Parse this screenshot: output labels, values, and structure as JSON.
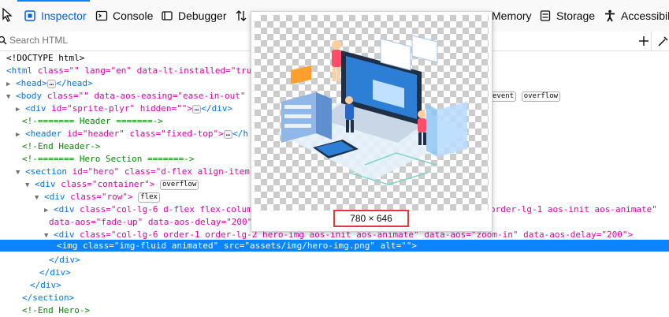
{
  "toolbar": {
    "tabs": [
      {
        "label": "Inspector",
        "icon": "inspector-icon"
      },
      {
        "label": "Console",
        "icon": "console-icon"
      },
      {
        "label": "Debugger",
        "icon": "debugger-icon"
      },
      {
        "label": "Memory",
        "icon": "memory-icon"
      },
      {
        "label": "Storage",
        "icon": "storage-icon"
      },
      {
        "label": "Accessibili",
        "icon": "accessibility-icon"
      }
    ]
  },
  "search": {
    "placeholder": "Search HTML"
  },
  "markup": {
    "l1": "<!DOCTYPE html>",
    "l2_tag": "<html",
    "l2_attrs": " class=\"\" lang=\"en\" data-lt-installed=\"tru",
    "l3": "<head>",
    "l3_end": "</head>",
    "l4_tag": "<body",
    "l4_attr": " class=\"\" data-aos-easing=\"ease-in-out\" d",
    "l4_badge1": "event",
    "l4_badge2": "overflow",
    "l5_tag": "<div",
    "l5_attr": " id=\"sprite-plyr\" hidden=\"\">",
    "l5_end": "</div>",
    "l6": "<!-======= Header =======->",
    "l7_tag": "<header",
    "l7_attr": " id=\"header\" class=\"fixed-top\">",
    "l7_end": "</h",
    "l8": "<!-End Header->",
    "l9": "<!-======= Hero Section =======->",
    "l10_tag": "<section",
    "l10_attr": " id=\"hero\" class=\"d-flex align-items",
    "l11_tag": "<div",
    "l11_attr": " class=\"container\">",
    "l11_badge": "overflow",
    "l12_tag": "<div",
    "l12_attr": " class=\"row\">",
    "l12_badge": "flex",
    "l13_tag": "<div",
    "l13_attr": " class=\"col-lg-6 d-flex flex-column",
    "l13_right": "order-lg-1 aos-init aos-animate\"",
    "l14_attr": "data-aos=\"fade-up\" data-aos-delay=\"200\"",
    "l15_tag": "<div",
    "l15_attr": " class=\"col-lg-6 order-1 order-lg-2 hero-img aos-init aos-animate\" data-aos=\"zoom-in\" data-aos-delay=\"200\">",
    "l16": "<img class=\"img-fluid animated\" src=\"assets/img/hero-img.png\" alt=\"\">",
    "l17": "</div>",
    "l18": "</div>",
    "l19": "</div>",
    "l20": "</section>",
    "l21": "<!-End Hero->",
    "ellipsis": "…"
  },
  "preview": {
    "dimensions": "780 × 646"
  },
  "colors": {
    "accent": "#0a84ff",
    "highlight_border": "#e03a3a"
  }
}
